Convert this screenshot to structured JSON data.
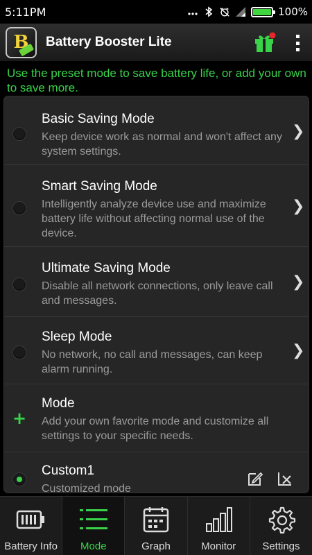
{
  "status_bar": {
    "time": "5:11PM",
    "battery_percent": "100%",
    "battery_level": 1.0,
    "icons": [
      "signal-dots-icon",
      "bluetooth-icon",
      "alarm-off-icon",
      "wifi-icon",
      "battery-icon"
    ]
  },
  "app_bar": {
    "title": "Battery Booster Lite",
    "logo_letter": "B",
    "icons": [
      "gift-icon",
      "overflow-menu-icon"
    ]
  },
  "hint": "Use the preset mode to save battery life, or add your own to save more.",
  "modes": [
    {
      "title": "Basic Saving Mode",
      "desc": "Keep device work as normal and won't affect any system settings.",
      "selected": false
    },
    {
      "title": "Smart Saving Mode",
      "desc": "Intelligently analyze device use and maximize battery life without affecting normal use of the device.",
      "selected": false
    },
    {
      "title": "Ultimate Saving Mode",
      "desc": "Disable all network connections, only leave call and messages.",
      "selected": false
    },
    {
      "title": "Sleep Mode",
      "desc": "No network, no call and messages, can keep alarm running.",
      "selected": false
    }
  ],
  "add_mode": {
    "title": "Mode",
    "desc": "Add your own favorite mode and customize all settings to your specific needs."
  },
  "custom_mode": {
    "title": "Custom1",
    "desc": "Customized mode",
    "selected": true
  },
  "bottom_nav": [
    {
      "label": "Battery Info",
      "icon": "battery-info-icon",
      "active": false
    },
    {
      "label": "Mode",
      "icon": "mode-list-icon",
      "active": true
    },
    {
      "label": "Graph",
      "icon": "calendar-graph-icon",
      "active": false
    },
    {
      "label": "Monitor",
      "icon": "bar-chart-icon",
      "active": false
    },
    {
      "label": "Settings",
      "icon": "gear-icon",
      "active": false
    }
  ],
  "colors": {
    "accent": "#39d34a",
    "background": "#000000",
    "card": "#262626",
    "text_secondary": "#9b9b9b",
    "badge": "#e8262b"
  }
}
